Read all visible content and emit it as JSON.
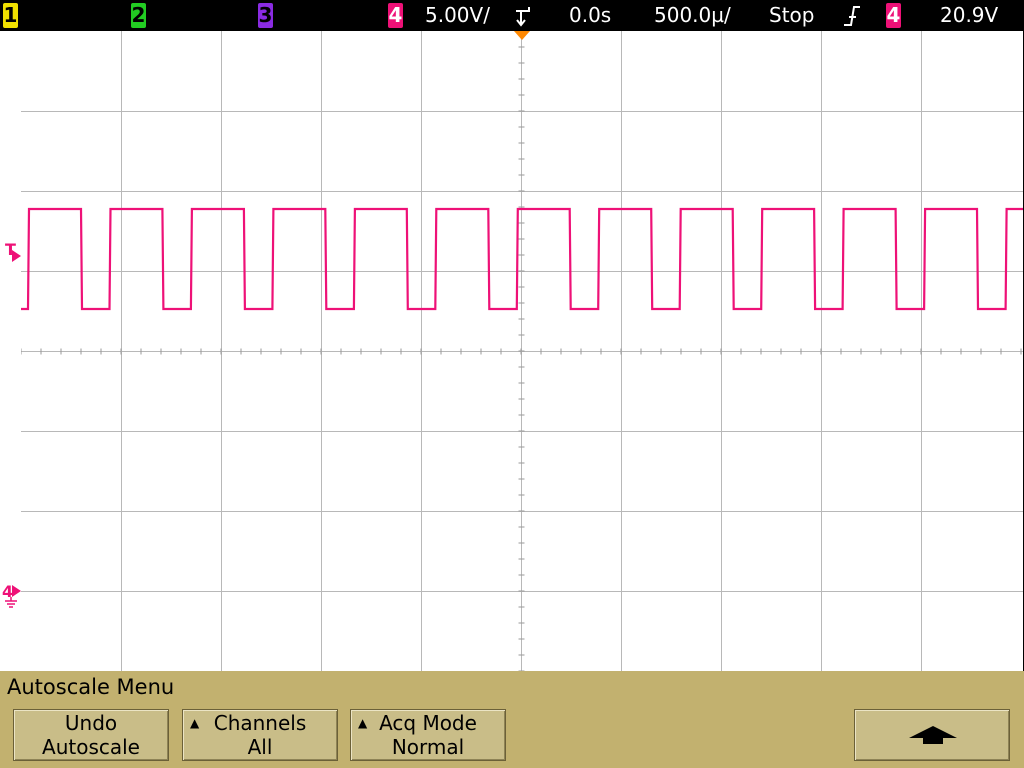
{
  "topbar": {
    "ch1": "1",
    "ch2": "2",
    "ch3": "3",
    "ch4": "4",
    "volts_per_div": "5.00V/",
    "time_offset": "0.0s",
    "time_per_div": "500.0µ/",
    "run_state": "Stop",
    "trigger_source": "4",
    "trigger_level": "20.9V"
  },
  "markers": {
    "trigger": "T",
    "ch4_ground": "4"
  },
  "menu": {
    "title": "Autoscale Menu",
    "undo": {
      "line1": "Undo",
      "line2": "Autoscale"
    },
    "channels": {
      "line1": "Channels",
      "line2": "All"
    },
    "acq_mode": {
      "line1": "Acq Mode",
      "line2": "Normal"
    },
    "up_icon": "up-arrow-icon"
  },
  "colors": {
    "ch1": "#f0e000",
    "ch2": "#22cc22",
    "ch3": "#8a2be2",
    "ch4": "#ee1177",
    "menu_bg": "#c2b16f",
    "trigger_marker": "#ff8800"
  },
  "waveform": {
    "channel": "4",
    "shape": "square",
    "periods_visible": 12.3,
    "duty_cycle": 0.65
  }
}
